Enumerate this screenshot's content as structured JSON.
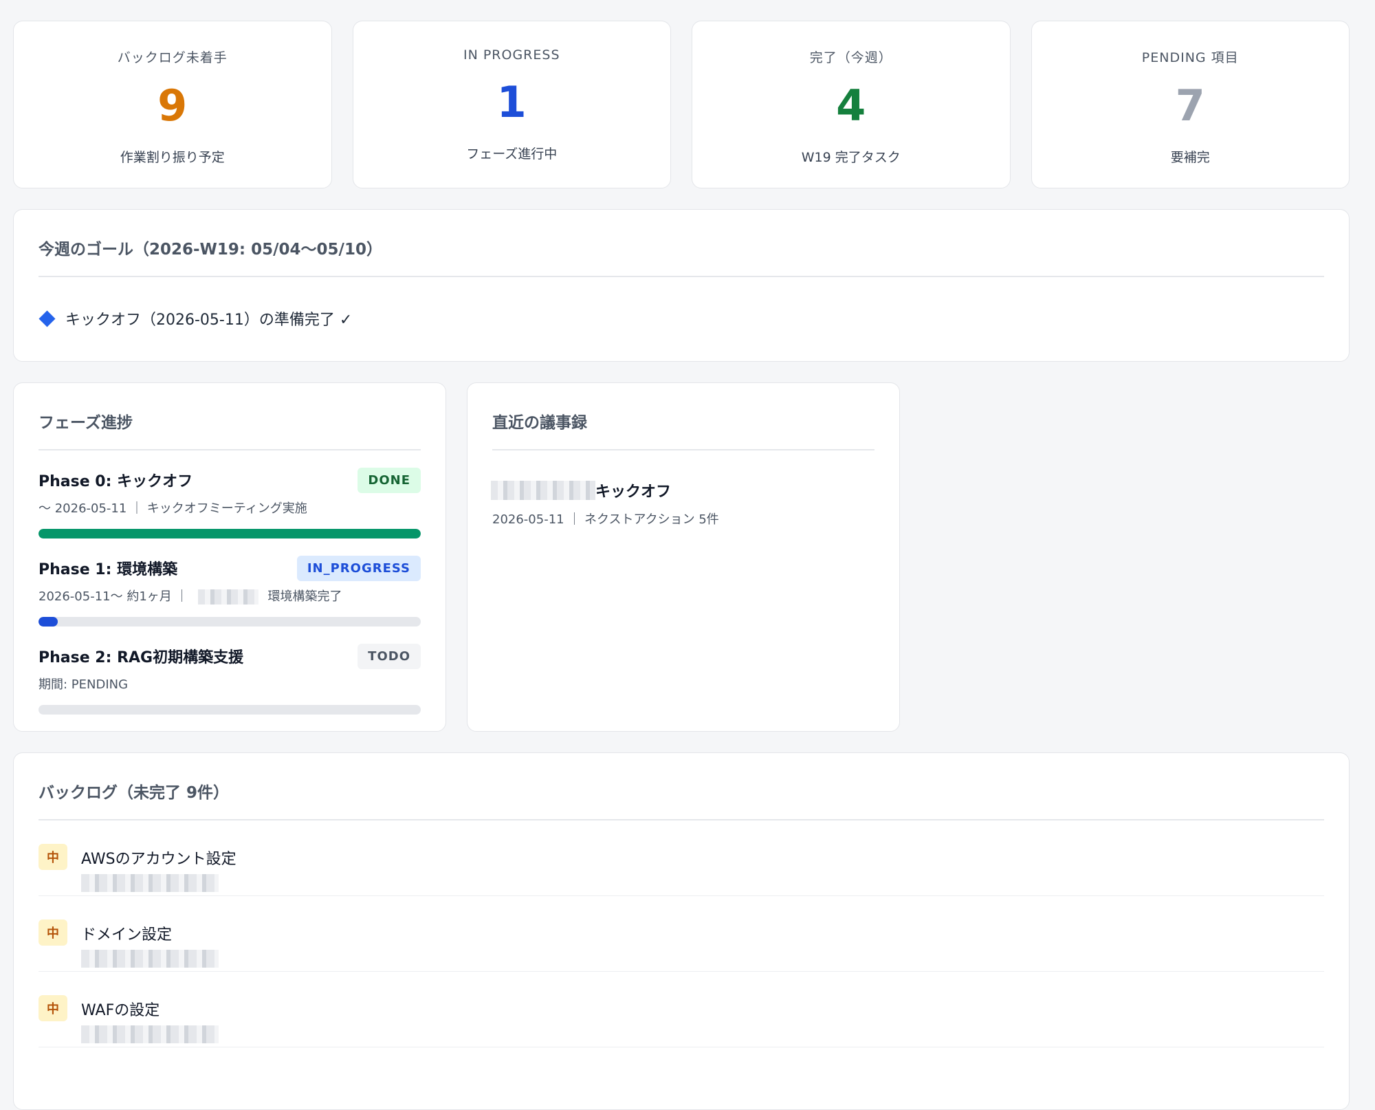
{
  "stats": [
    {
      "label": "バックログ未着手",
      "value": "9",
      "sub": "作業割り振り予定",
      "color": "#d97706"
    },
    {
      "label": "IN PROGRESS",
      "value": "1",
      "sub": "フェーズ進行中",
      "color": "#1d4ed8"
    },
    {
      "label": "完了（今週）",
      "value": "4",
      "sub": "W19 完了タスク",
      "color": "#15803d"
    },
    {
      "label": "PENDING 項目",
      "value": "7",
      "sub": "要補完",
      "color": "#9ca3af"
    }
  ],
  "goal": {
    "title": "今週のゴール（2026-W19: 05/04〜05/10）",
    "item": "キックオフ（2026-05-11）の準備完了 ✓"
  },
  "phases": {
    "title": "フェーズ進捗",
    "items": [
      {
        "name": "Phase 0: キックオフ",
        "status": "DONE",
        "meta_prefix": "〜 2026-05-11 ｜ キックオフミーティング実施",
        "meta_suffix": "",
        "progress": 1.0,
        "bar_color": "#059669"
      },
      {
        "name": "Phase 1: 環境構築",
        "status": "IN_PROGRESS",
        "meta_prefix": "2026-05-11〜 約1ヶ月 ｜",
        "meta_suffix": "環境構築完了",
        "progress": 0.05,
        "bar_color": "#1d4ed8"
      },
      {
        "name": "Phase 2: RAG初期構築支援",
        "status": "TODO",
        "meta_prefix": "期間: PENDING",
        "meta_suffix": "",
        "progress": 0.0,
        "bar_color": "#9ca3af"
      }
    ]
  },
  "minutes": {
    "title": "直近の議事録",
    "items": [
      {
        "title": "キックオフ",
        "meta": "2026-05-11 ｜ ネクストアクション 5件"
      }
    ]
  },
  "backlog": {
    "title": "バックログ（未完了 9件）",
    "items": [
      {
        "priority": "中",
        "title": "AWSのアカウント設定"
      },
      {
        "priority": "中",
        "title": "ドメイン設定"
      },
      {
        "priority": "中",
        "title": "WAFの設定"
      }
    ]
  }
}
